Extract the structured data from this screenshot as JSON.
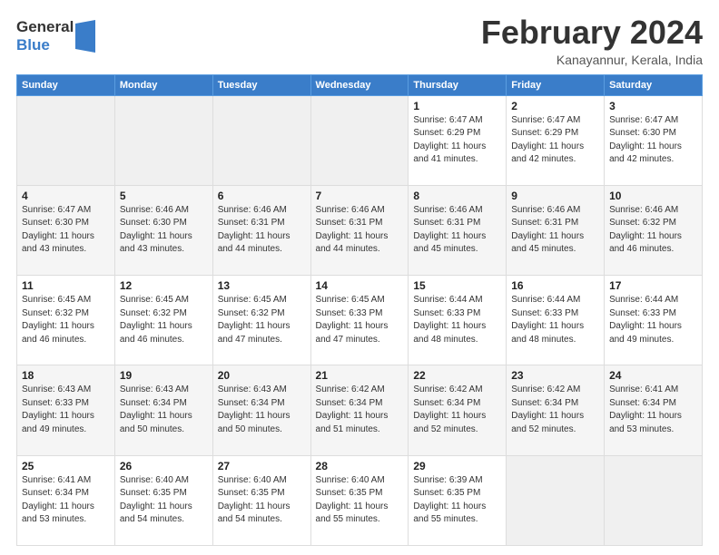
{
  "header": {
    "logo_general": "General",
    "logo_blue": "Blue",
    "month_title": "February 2024",
    "location": "Kanayannur, Kerala, India"
  },
  "calendar": {
    "days_of_week": [
      "Sunday",
      "Monday",
      "Tuesday",
      "Wednesday",
      "Thursday",
      "Friday",
      "Saturday"
    ],
    "weeks": [
      [
        {
          "day": "",
          "info": ""
        },
        {
          "day": "",
          "info": ""
        },
        {
          "day": "",
          "info": ""
        },
        {
          "day": "",
          "info": ""
        },
        {
          "day": "1",
          "info": "Sunrise: 6:47 AM\nSunset: 6:29 PM\nDaylight: 11 hours\nand 41 minutes."
        },
        {
          "day": "2",
          "info": "Sunrise: 6:47 AM\nSunset: 6:29 PM\nDaylight: 11 hours\nand 42 minutes."
        },
        {
          "day": "3",
          "info": "Sunrise: 6:47 AM\nSunset: 6:30 PM\nDaylight: 11 hours\nand 42 minutes."
        }
      ],
      [
        {
          "day": "4",
          "info": "Sunrise: 6:47 AM\nSunset: 6:30 PM\nDaylight: 11 hours\nand 43 minutes."
        },
        {
          "day": "5",
          "info": "Sunrise: 6:46 AM\nSunset: 6:30 PM\nDaylight: 11 hours\nand 43 minutes."
        },
        {
          "day": "6",
          "info": "Sunrise: 6:46 AM\nSunset: 6:31 PM\nDaylight: 11 hours\nand 44 minutes."
        },
        {
          "day": "7",
          "info": "Sunrise: 6:46 AM\nSunset: 6:31 PM\nDaylight: 11 hours\nand 44 minutes."
        },
        {
          "day": "8",
          "info": "Sunrise: 6:46 AM\nSunset: 6:31 PM\nDaylight: 11 hours\nand 45 minutes."
        },
        {
          "day": "9",
          "info": "Sunrise: 6:46 AM\nSunset: 6:31 PM\nDaylight: 11 hours\nand 45 minutes."
        },
        {
          "day": "10",
          "info": "Sunrise: 6:46 AM\nSunset: 6:32 PM\nDaylight: 11 hours\nand 46 minutes."
        }
      ],
      [
        {
          "day": "11",
          "info": "Sunrise: 6:45 AM\nSunset: 6:32 PM\nDaylight: 11 hours\nand 46 minutes."
        },
        {
          "day": "12",
          "info": "Sunrise: 6:45 AM\nSunset: 6:32 PM\nDaylight: 11 hours\nand 46 minutes."
        },
        {
          "day": "13",
          "info": "Sunrise: 6:45 AM\nSunset: 6:32 PM\nDaylight: 11 hours\nand 47 minutes."
        },
        {
          "day": "14",
          "info": "Sunrise: 6:45 AM\nSunset: 6:33 PM\nDaylight: 11 hours\nand 47 minutes."
        },
        {
          "day": "15",
          "info": "Sunrise: 6:44 AM\nSunset: 6:33 PM\nDaylight: 11 hours\nand 48 minutes."
        },
        {
          "day": "16",
          "info": "Sunrise: 6:44 AM\nSunset: 6:33 PM\nDaylight: 11 hours\nand 48 minutes."
        },
        {
          "day": "17",
          "info": "Sunrise: 6:44 AM\nSunset: 6:33 PM\nDaylight: 11 hours\nand 49 minutes."
        }
      ],
      [
        {
          "day": "18",
          "info": "Sunrise: 6:43 AM\nSunset: 6:33 PM\nDaylight: 11 hours\nand 49 minutes."
        },
        {
          "day": "19",
          "info": "Sunrise: 6:43 AM\nSunset: 6:34 PM\nDaylight: 11 hours\nand 50 minutes."
        },
        {
          "day": "20",
          "info": "Sunrise: 6:43 AM\nSunset: 6:34 PM\nDaylight: 11 hours\nand 50 minutes."
        },
        {
          "day": "21",
          "info": "Sunrise: 6:42 AM\nSunset: 6:34 PM\nDaylight: 11 hours\nand 51 minutes."
        },
        {
          "day": "22",
          "info": "Sunrise: 6:42 AM\nSunset: 6:34 PM\nDaylight: 11 hours\nand 52 minutes."
        },
        {
          "day": "23",
          "info": "Sunrise: 6:42 AM\nSunset: 6:34 PM\nDaylight: 11 hours\nand 52 minutes."
        },
        {
          "day": "24",
          "info": "Sunrise: 6:41 AM\nSunset: 6:34 PM\nDaylight: 11 hours\nand 53 minutes."
        }
      ],
      [
        {
          "day": "25",
          "info": "Sunrise: 6:41 AM\nSunset: 6:34 PM\nDaylight: 11 hours\nand 53 minutes."
        },
        {
          "day": "26",
          "info": "Sunrise: 6:40 AM\nSunset: 6:35 PM\nDaylight: 11 hours\nand 54 minutes."
        },
        {
          "day": "27",
          "info": "Sunrise: 6:40 AM\nSunset: 6:35 PM\nDaylight: 11 hours\nand 54 minutes."
        },
        {
          "day": "28",
          "info": "Sunrise: 6:40 AM\nSunset: 6:35 PM\nDaylight: 11 hours\nand 55 minutes."
        },
        {
          "day": "29",
          "info": "Sunrise: 6:39 AM\nSunset: 6:35 PM\nDaylight: 11 hours\nand 55 minutes."
        },
        {
          "day": "",
          "info": ""
        },
        {
          "day": "",
          "info": ""
        }
      ]
    ]
  }
}
